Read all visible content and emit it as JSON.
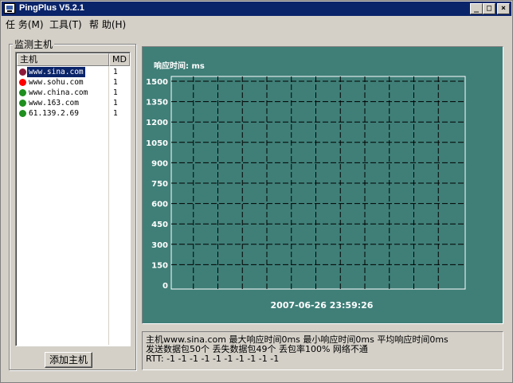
{
  "window": {
    "title": "PingPlus V5.2.1",
    "buttons": {
      "minimize": "_",
      "maximize": "□",
      "close": "×"
    }
  },
  "menu": [
    {
      "label": "任 务(M)"
    },
    {
      "label": "工具(T)"
    },
    {
      "label": "帮 助(H)"
    }
  ],
  "monitor": {
    "group_label": "监测主机",
    "columns": {
      "host": "主机",
      "md": "MD"
    },
    "hosts": [
      {
        "name": "www.sina.com",
        "md": "1",
        "status_color": "#8b1a3a",
        "selected": true
      },
      {
        "name": "www.sohu.com",
        "md": "1",
        "status_color": "#ff0000",
        "selected": false
      },
      {
        "name": "www.china.com",
        "md": "1",
        "status_color": "#1f8f1f",
        "selected": false
      },
      {
        "name": "www.163.com",
        "md": "1",
        "status_color": "#1f8f1f",
        "selected": false
      },
      {
        "name": "61.139.2.69",
        "md": "1",
        "status_color": "#1f8f1f",
        "selected": false
      }
    ],
    "add_button": "添加主机"
  },
  "chart": {
    "ylabel": "响应时间: ms",
    "timestamp": "2007-06-26   23:59:26",
    "background_color": "#3f7f78",
    "grid": true
  },
  "chart_data": {
    "type": "line",
    "title": "",
    "ylabel": "响应时间: ms",
    "yticks": [
      0,
      150,
      300,
      450,
      600,
      750,
      900,
      1050,
      1200,
      1350,
      1500
    ],
    "ylim": [
      0,
      1500
    ],
    "vertical_gridlines": 11,
    "series": []
  },
  "info": {
    "line1": "主机www.sina.com 最大响应时间0ms 最小响应时间0ms 平均响应时间0ms",
    "line2": " 发送数据包50个 丢失数据包49个 丢包率100% 网络不通",
    "line3": "RTT: -1 -1 -1 -1 -1 -1 -1 -1 -1 -1"
  }
}
